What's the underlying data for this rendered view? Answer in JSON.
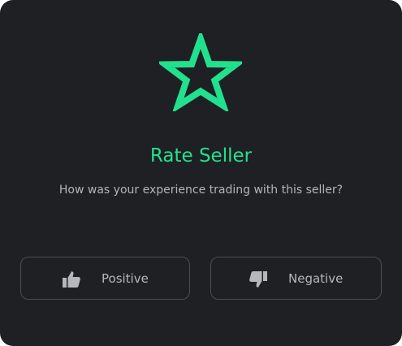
{
  "dialog": {
    "title": "Rate Seller",
    "subtitle": "How was your experience trading with this seller?",
    "icon": "star-outline-icon",
    "accent_color": "#21e18f",
    "background_color": "#1e2024"
  },
  "actions": {
    "positive": {
      "label": "Positive",
      "icon": "thumbs-up-icon"
    },
    "negative": {
      "label": "Negative",
      "icon": "thumbs-down-icon"
    }
  }
}
